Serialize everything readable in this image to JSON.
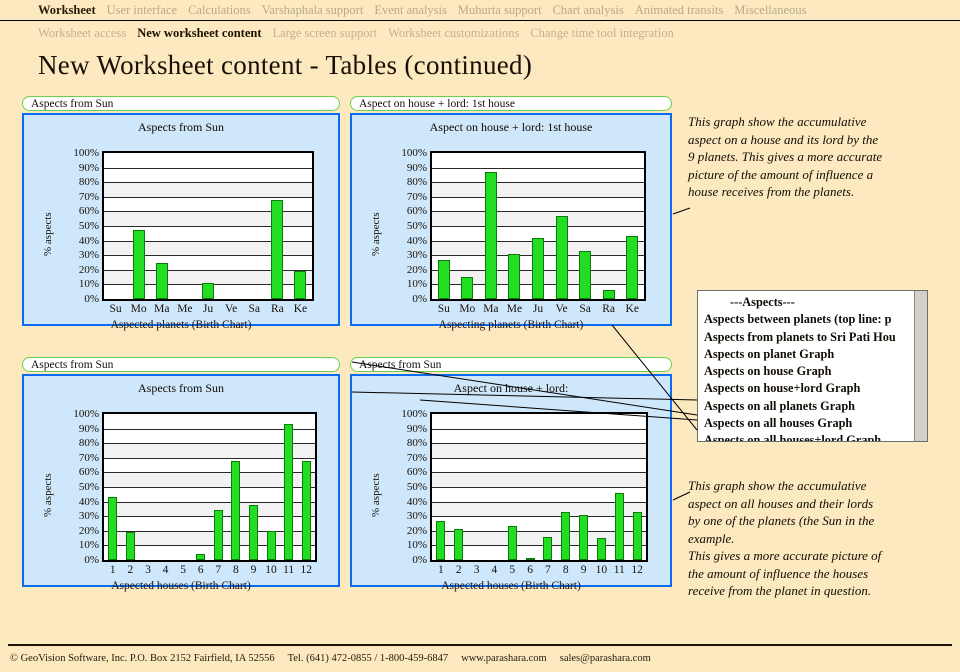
{
  "nav": {
    "primary": [
      {
        "label": "Worksheet",
        "active": true
      },
      {
        "label": "User interface",
        "active": false
      },
      {
        "label": "Calculations",
        "active": false
      },
      {
        "label": "Varshaphala support",
        "active": false
      },
      {
        "label": "Event analysis",
        "active": false
      },
      {
        "label": "Muhurta support",
        "active": false
      },
      {
        "label": "Chart analysis",
        "active": false
      },
      {
        "label": "Animated transits",
        "active": false
      },
      {
        "label": "Miscellaneous",
        "active": false
      }
    ],
    "secondary": [
      {
        "label": "Worksheet access",
        "active": false
      },
      {
        "label": "New worksheet content",
        "active": true
      },
      {
        "label": "Large screen support",
        "active": false
      },
      {
        "label": "Worksheet customizations",
        "active": false
      },
      {
        "label": "Change time tool integration",
        "active": false
      }
    ]
  },
  "page": {
    "title": "New Worksheet content - Tables (continued)"
  },
  "panels": [
    {
      "tab": "Aspects from Sun",
      "chart_index": 0
    },
    {
      "tab": "Aspect on house + lord: 1st house",
      "chart_index": 1
    },
    {
      "tab": "Aspects from Sun",
      "chart_index": 2
    },
    {
      "tab": "Aspects from Sun",
      "chart_index": 3
    }
  ],
  "chart_data": [
    {
      "type": "bar",
      "title": "Aspects from Sun",
      "xlabel": "Aspected planets (Birth Chart)",
      "ylabel": "% aspects",
      "ylim": [
        0,
        100
      ],
      "ytick_labels": [
        "0%",
        "10%",
        "20%",
        "30%",
        "40%",
        "50%",
        "60%",
        "70%",
        "80%",
        "90%",
        "100%"
      ],
      "grid": true,
      "categories": [
        "Su",
        "Mo",
        "Ma",
        "Me",
        "Ju",
        "Ve",
        "Sa",
        "Ra",
        "Ke"
      ],
      "values": [
        0,
        47,
        25,
        0,
        11,
        0,
        0,
        68,
        19
      ]
    },
    {
      "type": "bar",
      "title": "Aspect on house + lord: 1st house",
      "xlabel": "Aspecting planets (Birth Chart)",
      "ylabel": "% aspects",
      "ylim": [
        0,
        100
      ],
      "ytick_labels": [
        "0%",
        "10%",
        "20%",
        "30%",
        "40%",
        "50%",
        "60%",
        "70%",
        "80%",
        "90%",
        "100%"
      ],
      "grid": true,
      "categories": [
        "Su",
        "Mo",
        "Ma",
        "Me",
        "Ju",
        "Ve",
        "Sa",
        "Ra",
        "Ke"
      ],
      "values": [
        27,
        15,
        87,
        31,
        42,
        57,
        33,
        6,
        43
      ]
    },
    {
      "type": "bar",
      "title": "Aspects from Sun",
      "xlabel": "Aspected houses (Birth Chart)",
      "ylabel": "% aspects",
      "ylim": [
        0,
        100
      ],
      "ytick_labels": [
        "0%",
        "10%",
        "20%",
        "30%",
        "40%",
        "50%",
        "60%",
        "70%",
        "80%",
        "90%",
        "100%"
      ],
      "grid": true,
      "categories": [
        "1",
        "2",
        "3",
        "4",
        "5",
        "6",
        "7",
        "8",
        "9",
        "10",
        "11",
        "12"
      ],
      "values": [
        43,
        19,
        0,
        0,
        0,
        4,
        34,
        68,
        38,
        20,
        93,
        68
      ]
    },
    {
      "type": "bar",
      "title": "Aspect on house + lord:",
      "xlabel": "Aspected houses (Birth Chart)",
      "ylabel": "% aspects",
      "ylim": [
        0,
        100
      ],
      "ytick_labels": [
        "0%",
        "10%",
        "20%",
        "30%",
        "40%",
        "50%",
        "60%",
        "70%",
        "80%",
        "90%",
        "100%"
      ],
      "grid": true,
      "categories": [
        "1",
        "2",
        "3",
        "4",
        "5",
        "6",
        "7",
        "8",
        "9",
        "10",
        "11",
        "12"
      ],
      "values": [
        27,
        21,
        0,
        0,
        23,
        1.5,
        16,
        33,
        31,
        15,
        46,
        33
      ]
    }
  ],
  "listbox": {
    "items": [
      "---Aspects---",
      "Aspects between planets (top line: p",
      "Aspects from planets to Sri Pati Hou",
      "Aspects on planet Graph",
      "Aspects on house Graph",
      "Aspects on house+lord Graph",
      "Aspects on all planets Graph",
      "Aspects on all houses Graph",
      "Aspects on all houses+lord Graph"
    ]
  },
  "annotations": {
    "top_right": "This graph show the accumulative aspect on a house and its lord by the 9 planets. This gives a more accurate picture of the amount of influence a house receives from the planets.",
    "top_right_lines": [
      "This graph show the accumulative",
      "aspect on a house and its lord by the",
      "9 planets. This gives a more accurate",
      "picture of the amount of influence a",
      "house receives from the planets."
    ],
    "bottom_right_lines": [
      "This graph show the accumulative",
      "aspect on all houses and their lords",
      "by one of the planets (the Sun in the",
      "example.",
      "This gives a more accurate picture of",
      "the amount of influence the houses",
      "receive from the planet in question."
    ]
  },
  "footer": {
    "copyright": "© GeoVision Software, Inc. P.O. Box 2152 Fairfield, IA 52556",
    "phone": "Tel. (641) 472-0855 / 1-800-459-6847",
    "website": "www.parashara.com",
    "email": "sales@parashara.com"
  },
  "colors": {
    "page_background": "#fce9c0",
    "panel_border": "#0a6df0",
    "panel_fill": "#cfe7fa",
    "tab_border": "#6ad14a",
    "bar_fill": "#22dd22",
    "bar_edge": "#0b7a0b",
    "nav_inactive": "#b9a88a",
    "nav_active": "#2a1a08"
  }
}
